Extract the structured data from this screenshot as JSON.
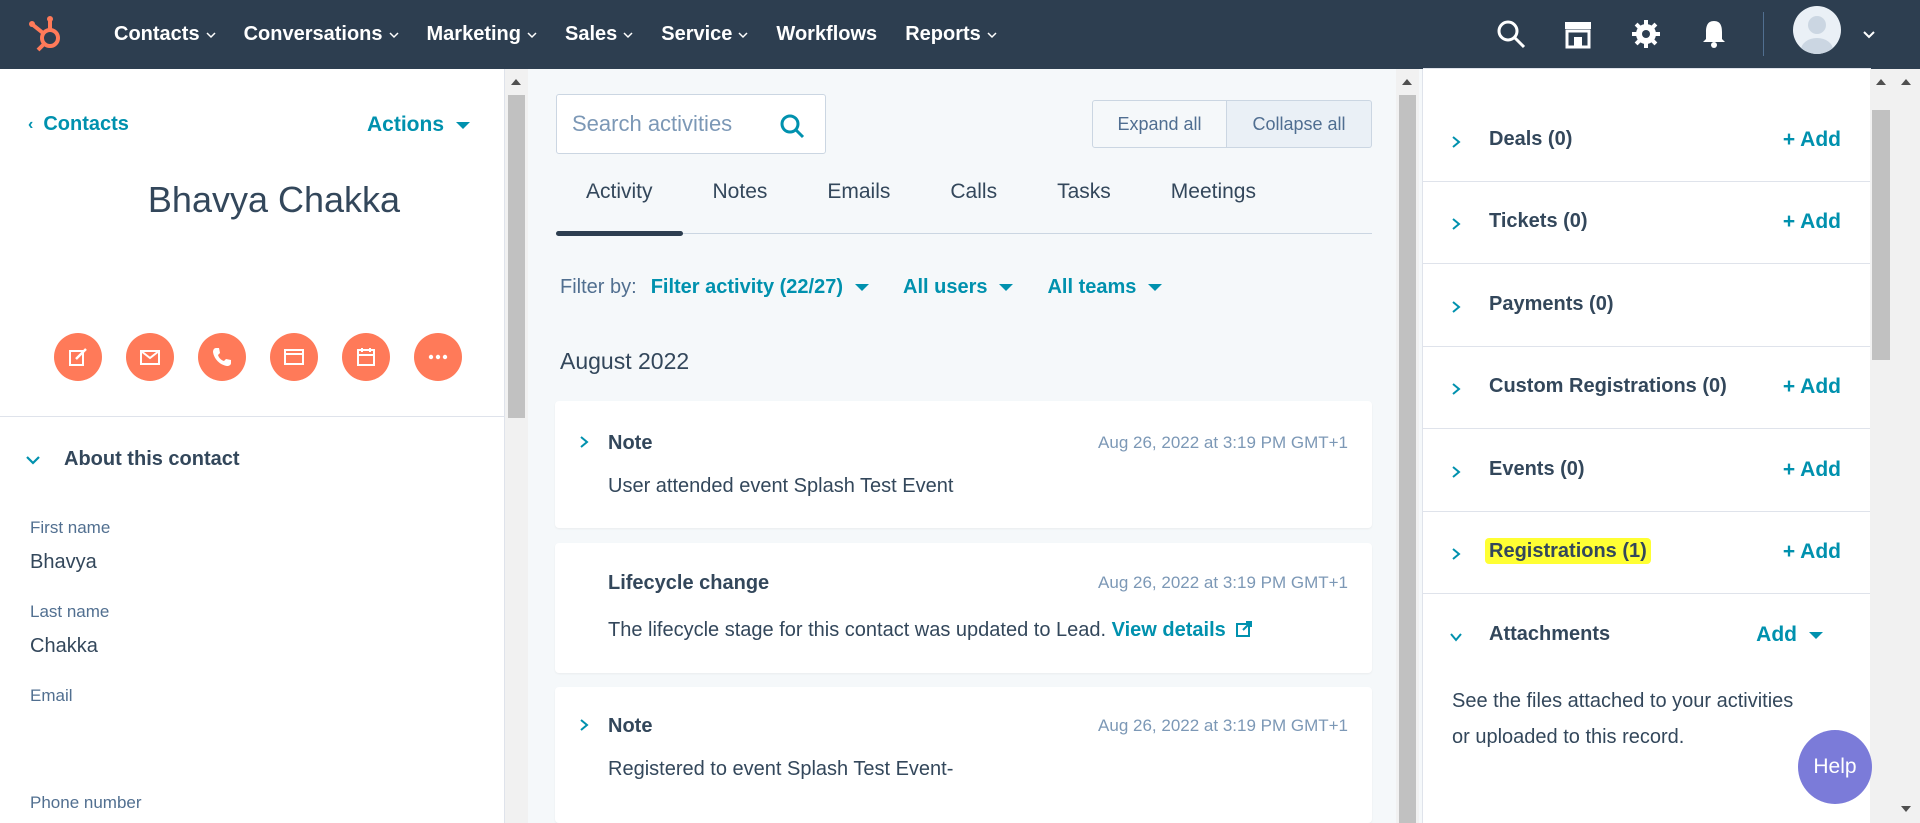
{
  "nav": {
    "items": [
      {
        "label": "Contacts",
        "has_caret": true
      },
      {
        "label": "Conversations",
        "has_caret": true
      },
      {
        "label": "Marketing",
        "has_caret": true
      },
      {
        "label": "Sales",
        "has_caret": true
      },
      {
        "label": "Service",
        "has_caret": true
      },
      {
        "label": "Workflows",
        "has_caret": false
      },
      {
        "label": "Reports",
        "has_caret": true
      }
    ],
    "icons": [
      "search-icon",
      "marketplace-icon",
      "settings-gear-icon",
      "notifications-bell-icon"
    ]
  },
  "left": {
    "back_label": "Contacts",
    "actions_label": "Actions",
    "contact_name": "Bhavya Chakka",
    "action_buttons": [
      "note-icon",
      "email-icon",
      "call-icon",
      "task-icon",
      "meeting-icon",
      "more-icon"
    ],
    "about_label": "About this contact",
    "properties": [
      {
        "label": "First name",
        "value": "Bhavya"
      },
      {
        "label": "Last name",
        "value": "Chakka"
      },
      {
        "label": "Email",
        "value": ""
      },
      {
        "label": "Phone number",
        "value": ""
      }
    ]
  },
  "center": {
    "search_placeholder": "Search activities",
    "expand_all": "Expand all",
    "collapse_all": "Collapse all",
    "tabs": [
      "Activity",
      "Notes",
      "Emails",
      "Calls",
      "Tasks",
      "Meetings"
    ],
    "active_tab": "Activity",
    "filter_label": "Filter by:",
    "filters": [
      "Filter activity (22/27)",
      "All users",
      "All teams"
    ],
    "month": "August 2022",
    "cards": [
      {
        "title": "Note",
        "time": "Aug 26, 2022 at 3:19 PM GMT+1",
        "body": "User attended event Splash Test Event",
        "expandable": true
      },
      {
        "title": "Lifecycle change",
        "time": "Aug 26, 2022 at 3:19 PM GMT+1",
        "body": "The lifecycle stage for this contact was updated to Lead.",
        "link": "View details",
        "expandable": false
      },
      {
        "title": "Note",
        "time": "Aug 26, 2022 at 3:19 PM GMT+1",
        "body": "Registered to event Splash Test Event-",
        "expandable": true
      }
    ]
  },
  "right": {
    "sections": [
      {
        "title": "Deals (0)",
        "add": "+ Add"
      },
      {
        "title": "Tickets (0)",
        "add": "+ Add"
      },
      {
        "title": "Payments (0)",
        "add": ""
      },
      {
        "title": "Custom Registrations (0)",
        "add": "+ Add"
      },
      {
        "title": "Events (0)",
        "add": "+ Add"
      },
      {
        "title": "Registrations (1)",
        "add": "+ Add",
        "highlighted": true
      },
      {
        "title": "Attachments",
        "add": "Add"
      }
    ],
    "attachments_text": "See the files attached to your activities or uploaded to this record."
  },
  "help_label": "Help",
  "colors": {
    "nav_bg": "#2d3e50",
    "accent_orange": "#ff7a59",
    "link_teal": "#0091ae",
    "highlight": "#ffff33",
    "help_purple": "#7b7bd9"
  }
}
